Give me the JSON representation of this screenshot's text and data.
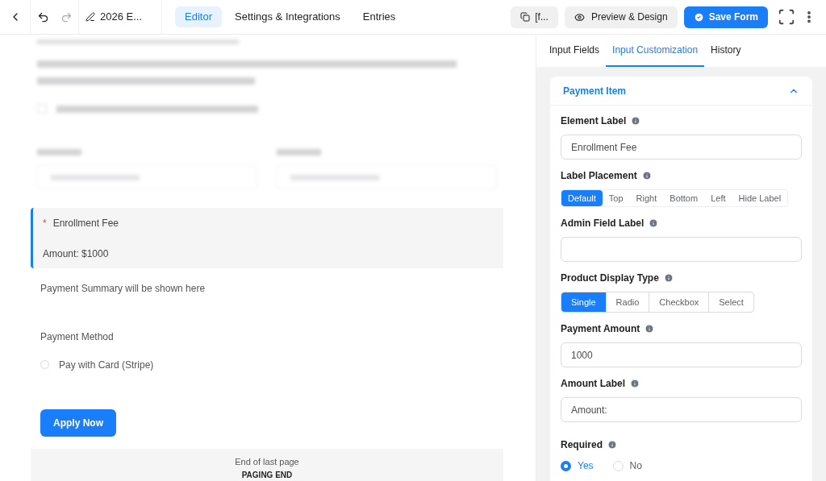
{
  "topbar": {
    "form_title": "2026 E...",
    "nav": [
      {
        "label": "Editor",
        "selected": true
      },
      {
        "label": "Settings & Integrations",
        "selected": false
      },
      {
        "label": "Entries",
        "selected": false
      }
    ],
    "shortcode_button": "[f...",
    "preview_button": "Preview & Design",
    "save_button": "Save Form"
  },
  "canvas": {
    "payment_item": {
      "required_mark": "*",
      "label": "Enrollment Fee",
      "amount": "Amount: $1000"
    },
    "summary_text": "Payment Summary will be shown here",
    "payment_method": {
      "label": "Payment Method",
      "options": [
        {
          "label": "Pay with Card (Stripe)",
          "selected": false
        }
      ]
    },
    "submit_button": "Apply Now",
    "page_end": {
      "caption": "End of last page",
      "title": "PAGING END"
    }
  },
  "sidebar": {
    "tabs": [
      {
        "label": "Input Fields",
        "selected": false
      },
      {
        "label": "Input Customization",
        "selected": true
      },
      {
        "label": "History",
        "selected": false
      }
    ],
    "section": {
      "title": "Payment Item",
      "expanded": true,
      "fields": [
        {
          "kind": "text",
          "label": "Element Label",
          "value": "Enrollment Fee"
        },
        {
          "kind": "segments",
          "label": "Label Placement",
          "options": [
            {
              "label": "Default",
              "selected": true
            },
            {
              "label": "Top",
              "selected": false
            },
            {
              "label": "Right",
              "selected": false
            },
            {
              "label": "Bottom",
              "selected": false
            },
            {
              "label": "Left",
              "selected": false
            },
            {
              "label": "Hide Label",
              "selected": false
            }
          ]
        },
        {
          "kind": "text",
          "label": "Admin Field Label"
        },
        {
          "kind": "buttons",
          "label": "Product Display Type",
          "options": [
            {
              "label": "Single",
              "selected": true
            },
            {
              "label": "Radio",
              "selected": false
            },
            {
              "label": "Checkbox",
              "selected": false
            },
            {
              "label": "Select",
              "selected": false
            }
          ]
        },
        {
          "kind": "text",
          "label": "Payment Amount",
          "value": "1000"
        },
        {
          "kind": "text",
          "label": "Amount Label",
          "value": "Amount:"
        },
        {
          "kind": "radio",
          "label": "Required",
          "options": [
            {
              "label": "Yes",
              "selected": true
            },
            {
              "label": "No",
              "selected": false
            }
          ]
        }
      ]
    }
  }
}
